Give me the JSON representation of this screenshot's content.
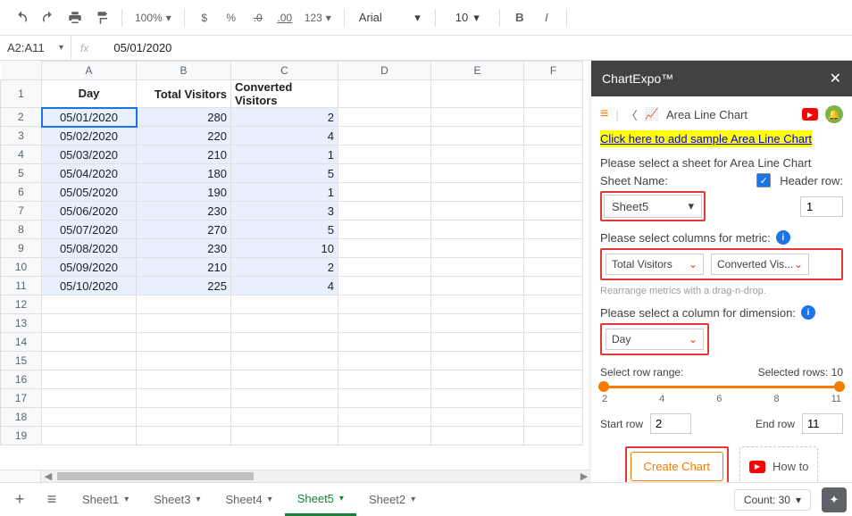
{
  "toolbar": {
    "zoom": "100%",
    "currency": "$",
    "percent": "%",
    "decdec": ".0",
    "incdec": ".00",
    "numfmt": "123",
    "font": "Arial",
    "fontsize": "10",
    "bold": "B",
    "italic": "I"
  },
  "formula_bar": {
    "namebox": "A2:A11",
    "fx": "fx",
    "value": "05/01/2020"
  },
  "columns": [
    "A",
    "B",
    "C",
    "D",
    "E",
    "F"
  ],
  "headers": {
    "A": "Day",
    "B": "Total Visitors",
    "C": "Converted Visitors"
  },
  "rows": [
    {
      "n": 2,
      "day": "05/01/2020",
      "tv": "280",
      "cv": "2"
    },
    {
      "n": 3,
      "day": "05/02/2020",
      "tv": "220",
      "cv": "4"
    },
    {
      "n": 4,
      "day": "05/03/2020",
      "tv": "210",
      "cv": "1"
    },
    {
      "n": 5,
      "day": "05/04/2020",
      "tv": "180",
      "cv": "5"
    },
    {
      "n": 6,
      "day": "05/05/2020",
      "tv": "190",
      "cv": "1"
    },
    {
      "n": 7,
      "day": "05/06/2020",
      "tv": "230",
      "cv": "3"
    },
    {
      "n": 8,
      "day": "05/07/2020",
      "tv": "270",
      "cv": "5"
    },
    {
      "n": 9,
      "day": "05/08/2020",
      "tv": "230",
      "cv": "10"
    },
    {
      "n": 10,
      "day": "05/09/2020",
      "tv": "210",
      "cv": "2"
    },
    {
      "n": 11,
      "day": "05/10/2020",
      "tv": "225",
      "cv": "4"
    }
  ],
  "empty_rows": [
    12,
    13,
    14,
    15,
    16,
    17,
    18,
    19
  ],
  "sheets": {
    "tabs": [
      "Sheet1",
      "Sheet3",
      "Sheet4",
      "Sheet5",
      "Sheet2"
    ],
    "active": "Sheet5"
  },
  "status": {
    "count_label": "Count: 30"
  },
  "sidebar": {
    "title": "ChartExpo™",
    "chart_type": "Area Line Chart",
    "sample_link": "Click here to add sample Area Line Chart",
    "prompt_sheet": "Please select a sheet for Area Line Chart",
    "sheet_name_label": "Sheet Name:",
    "sheet_name_value": "Sheet5",
    "header_row_label": "Header row:",
    "header_row_value": "1",
    "prompt_metric": "Please select columns for metric:",
    "metric1": "Total Visitors",
    "metric2": "Converted Vis...",
    "metric_hint": "Rearrange metrics with a drag-n-drop.",
    "prompt_dimension": "Please select a column for dimension:",
    "dimension": "Day",
    "range_label": "Select row range:",
    "selected_rows": "Selected rows: 10",
    "ticks": [
      "2",
      "4",
      "6",
      "8",
      "11"
    ],
    "start_row_label": "Start row",
    "start_row": "2",
    "end_row_label": "End row",
    "end_row": "11",
    "create_label": "Create Chart",
    "howto_label": "How to"
  },
  "chart_data": {
    "type": "table",
    "title": "Area Line Chart source data",
    "columns": [
      "Day",
      "Total Visitors",
      "Converted Visitors"
    ],
    "records": [
      [
        "05/01/2020",
        280,
        2
      ],
      [
        "05/02/2020",
        220,
        4
      ],
      [
        "05/03/2020",
        210,
        1
      ],
      [
        "05/04/2020",
        180,
        5
      ],
      [
        "05/05/2020",
        190,
        1
      ],
      [
        "05/06/2020",
        230,
        3
      ],
      [
        "05/07/2020",
        270,
        5
      ],
      [
        "05/08/2020",
        230,
        10
      ],
      [
        "05/09/2020",
        210,
        2
      ],
      [
        "05/10/2020",
        225,
        4
      ]
    ]
  }
}
